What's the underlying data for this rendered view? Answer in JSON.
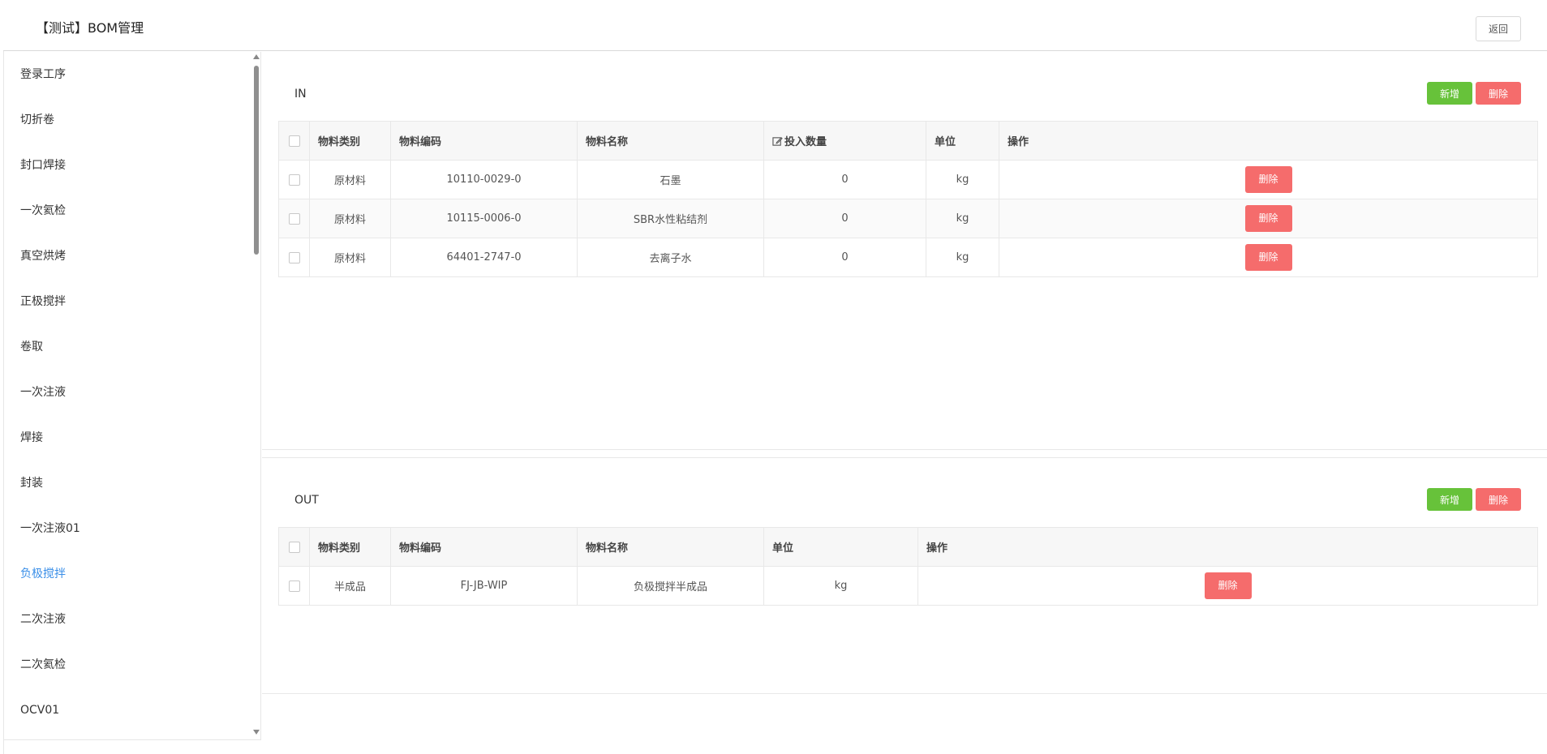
{
  "header": {
    "title": "【测试】BOM管理",
    "back_label": "返回"
  },
  "sidebar": {
    "items": [
      {
        "label": "登录工序"
      },
      {
        "label": "切折卷"
      },
      {
        "label": "封口焊接"
      },
      {
        "label": "一次氦检"
      },
      {
        "label": "真空烘烤"
      },
      {
        "label": "正极搅拌"
      },
      {
        "label": "卷取"
      },
      {
        "label": "一次注液"
      },
      {
        "label": "焊接"
      },
      {
        "label": "封装"
      },
      {
        "label": "一次注液01"
      },
      {
        "label": "负极搅拌",
        "active": true
      },
      {
        "label": "二次注液"
      },
      {
        "label": "二次氦检"
      },
      {
        "label": "OCV01"
      }
    ]
  },
  "in_section": {
    "label": "IN",
    "add_label": "新增",
    "delete_label": "删除",
    "columns": [
      "物料类别",
      "物料编码",
      "物料名称",
      "投入数量",
      "单位",
      "操作"
    ],
    "rows": [
      {
        "category": "原材料",
        "code": "10110-0029-0",
        "name": "石墨",
        "qty": "0",
        "unit": "kg",
        "action": "删除"
      },
      {
        "category": "原材料",
        "code": "10115-0006-0",
        "name": "SBR水性粘结剂",
        "qty": "0",
        "unit": "kg",
        "action": "删除"
      },
      {
        "category": "原材料",
        "code": "64401-2747-0",
        "name": "去离子水",
        "qty": "0",
        "unit": "kg",
        "action": "删除"
      }
    ]
  },
  "out_section": {
    "label": "OUT",
    "add_label": "新增",
    "delete_label": "删除",
    "columns": [
      "物料类别",
      "物料编码",
      "物料名称",
      "单位",
      "操作"
    ],
    "rows": [
      {
        "category": "半成品",
        "code": "FJ-JB-WIP",
        "name": "负极搅拌半成品",
        "unit": "kg",
        "action": "删除"
      }
    ]
  },
  "colors": {
    "accent": "#3b8fe8",
    "add": "#67c23a",
    "delete": "#f56c6c"
  },
  "icons": {
    "edit": "edit-icon",
    "scroll_up": "chevron-up-icon",
    "scroll_down": "chevron-down-icon"
  }
}
